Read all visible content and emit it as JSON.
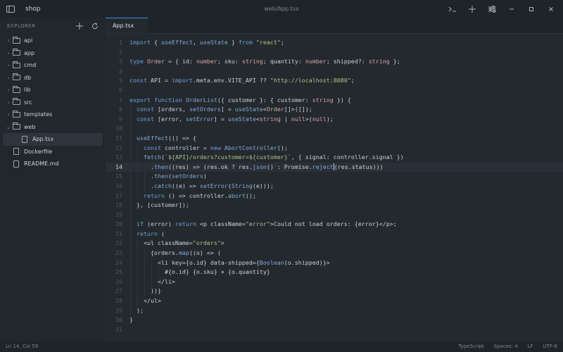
{
  "titlebar": {
    "project": "shop",
    "path": "web/App.tsx"
  },
  "explorer": {
    "title": "EXPLORER",
    "items": [
      {
        "label": "api",
        "kind": "folder",
        "open": false,
        "depth": 0
      },
      {
        "label": "app",
        "kind": "folder",
        "open": false,
        "depth": 0
      },
      {
        "label": "cmd",
        "kind": "folder",
        "open": false,
        "depth": 0
      },
      {
        "label": "db",
        "kind": "folder",
        "open": false,
        "depth": 0
      },
      {
        "label": "lib",
        "kind": "folder",
        "open": false,
        "depth": 0
      },
      {
        "label": "src",
        "kind": "folder",
        "open": false,
        "depth": 0
      },
      {
        "label": "templates",
        "kind": "folder",
        "open": false,
        "depth": 0
      },
      {
        "label": "web",
        "kind": "folder",
        "open": true,
        "depth": 0
      },
      {
        "label": "App.tsx",
        "kind": "file",
        "depth": 1,
        "active": true
      },
      {
        "label": "Dockerfile",
        "kind": "file",
        "depth": 0
      },
      {
        "label": "README.md",
        "kind": "file",
        "depth": 0
      }
    ]
  },
  "tabs": [
    {
      "label": "App.tsx",
      "active": true
    }
  ],
  "editor": {
    "current_line": 14,
    "cursor_col": 59,
    "lines": [
      {
        "n": "1",
        "indent": 0,
        "text": "import { useEffect, useState } from \"react\";"
      },
      {
        "n": "2",
        "indent": 0,
        "text": ""
      },
      {
        "n": "3",
        "indent": 0,
        "text": "type Order = { id: number; sku: string; quantity: number; shipped?: string };"
      },
      {
        "n": "4",
        "indent": 0,
        "text": ""
      },
      {
        "n": "5",
        "indent": 0,
        "text": "const API = import.meta.env.VITE_API ?? \"http://localhost:8080\";"
      },
      {
        "n": "6",
        "indent": 0,
        "text": ""
      },
      {
        "n": "7",
        "indent": 0,
        "text": "export function OrderList({ customer }: { customer: string }) {"
      },
      {
        "n": "8",
        "indent": 1,
        "text": "  const [orders, setOrders] = useState<Order[]>([]);"
      },
      {
        "n": "9",
        "indent": 1,
        "text": "  const [error, setError] = useState<string | null>(null);"
      },
      {
        "n": "10",
        "indent": 1,
        "text": ""
      },
      {
        "n": "11",
        "indent": 1,
        "text": "  useEffect(() => {"
      },
      {
        "n": "12",
        "indent": 2,
        "text": "    const controller = new AbortController();"
      },
      {
        "n": "13",
        "indent": 2,
        "text": "    fetch(`${API}/orders?customer=${customer}`, { signal: controller.signal })"
      },
      {
        "n": "14",
        "indent": 3,
        "text": "      .then((res) => (res.ok ? res.json() : Promise.reject(res.status)))"
      },
      {
        "n": "15",
        "indent": 3,
        "text": "      .then(setOrders)"
      },
      {
        "n": "16",
        "indent": 3,
        "text": "      .catch((e) => setError(String(e)));"
      },
      {
        "n": "17",
        "indent": 2,
        "text": "    return () => controller.abort();"
      },
      {
        "n": "18",
        "indent": 1,
        "text": "  }, [customer]);"
      },
      {
        "n": "19",
        "indent": 1,
        "text": ""
      },
      {
        "n": "20",
        "indent": 1,
        "text": "  if (error) return <p className=\"error\">Could not load orders: {error}</p>;"
      },
      {
        "n": "21",
        "indent": 1,
        "text": "  return ("
      },
      {
        "n": "22",
        "indent": 2,
        "text": "    <ul className=\"orders\">"
      },
      {
        "n": "23",
        "indent": 3,
        "text": "      {orders.map((o) => ("
      },
      {
        "n": "24",
        "indent": 4,
        "text": "        <li key={o.id} data-shipped={Boolean(o.shipped)}>"
      },
      {
        "n": "25",
        "indent": 5,
        "text": "          #{o.id} {o.sku} × {o.quantity}"
      },
      {
        "n": "26",
        "indent": 4,
        "text": "        </li>"
      },
      {
        "n": "27",
        "indent": 3,
        "text": "      ))}"
      },
      {
        "n": "28",
        "indent": 2,
        "text": "    </ul>"
      },
      {
        "n": "29",
        "indent": 1,
        "text": "  );"
      },
      {
        "n": "30",
        "indent": 0,
        "text": "}"
      },
      {
        "n": "31",
        "indent": 0,
        "text": ""
      }
    ]
  },
  "status": {
    "position": "Ln 14, Col 59",
    "language": "TypeScript",
    "spaces": "Spaces: 4",
    "eol": "LF",
    "encoding": "UTF-8"
  },
  "colors": {
    "accent": "#3a8ee6",
    "editor_bg": "#24292e",
    "sidebar_bg": "#22272c"
  }
}
